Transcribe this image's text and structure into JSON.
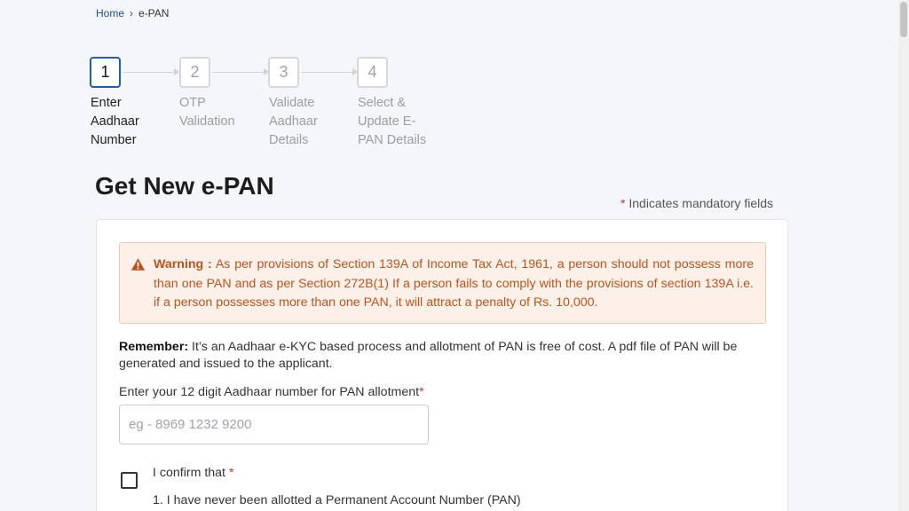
{
  "breadcrumb": {
    "home": "Home",
    "separator": "›",
    "current": "e-PAN"
  },
  "stepper": {
    "steps": [
      {
        "number": "1",
        "label": "Enter Aadhaar Number"
      },
      {
        "number": "2",
        "label": "OTP Validation"
      },
      {
        "number": "3",
        "label": "Validate Aadhaar Details"
      },
      {
        "number": "4",
        "label": "Select & Update E-PAN Details"
      }
    ],
    "active_step": 1
  },
  "page": {
    "title": "Get New e-PAN",
    "mandatory_star": "*",
    "mandatory_note": "Indicates mandatory fields"
  },
  "warning": {
    "icon": "warning-triangle-icon",
    "label": "Warning :",
    "text": "As per provisions of Section 139A of Income Tax Act, 1961, a person should not possess more than one PAN and as per Section 272B(1) If a person fails to comply with the provisions of section 139A i.e. if a person possesses more than one PAN, it will attract a penalty of Rs. 10,000."
  },
  "remember": {
    "label": "Remember:",
    "text": "It’s an Aadhaar e-KYC based process and allotment of PAN is free of cost. A pdf file of PAN will be generated and issued to the applicant."
  },
  "aadhaar_field": {
    "label": "Enter your 12 digit Aadhaar number for PAN allotment",
    "required_star": "*",
    "placeholder": "eg - 8969 1232 9200",
    "value": ""
  },
  "confirm": {
    "label": "I confirm that",
    "required_star": "*",
    "items": [
      "1. I have never been allotted a Permanent Account Number (PAN)"
    ]
  },
  "colors": {
    "accent": "#1f5fa8",
    "warning_text": "#b85420",
    "warning_bg": "#fdf0e8",
    "required": "#c0392b"
  }
}
